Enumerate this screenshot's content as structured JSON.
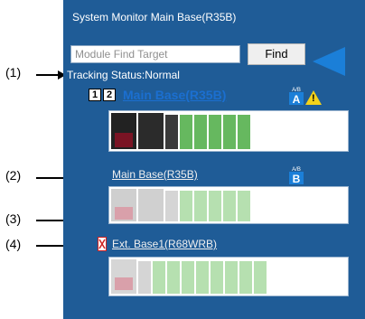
{
  "panel": {
    "title": "System Monitor Main Base(R35B)",
    "search_placeholder": "Module Find Target",
    "find_label": "Find",
    "tracking_status": "Tracking Status:Normal"
  },
  "callouts": [
    "(1)",
    "(2)",
    "(3)",
    "(4)"
  ],
  "bases": [
    {
      "label": "Main Base(R35B)",
      "style": "bold",
      "nums": [
        "1",
        "2"
      ],
      "icon": "A"
    },
    {
      "label": "Main Base(R35B)",
      "style": "normal",
      "icon": "B"
    },
    {
      "label": "Ext. Base1(R68WRB)",
      "style": "normal"
    }
  ],
  "colors": {
    "panel_bg": "#1f5c97",
    "accent_blue": "#1b7fd8",
    "module_green": "#66b85f",
    "warning": "#f3d21a"
  }
}
